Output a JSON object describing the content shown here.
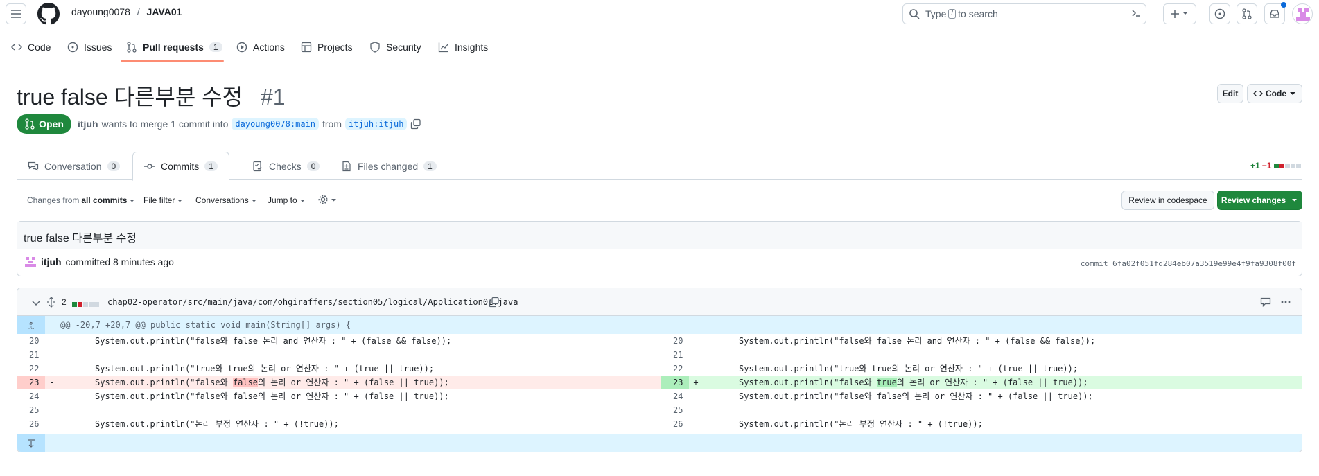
{
  "header": {
    "owner": "dayoung0078",
    "separator": "/",
    "repo": "JAVA01",
    "search_prefix": "Type",
    "search_key": "/",
    "search_suffix": "to search"
  },
  "repo_nav": [
    {
      "label": "Code",
      "icon": "code-icon"
    },
    {
      "label": "Issues",
      "icon": "issue-icon"
    },
    {
      "label": "Pull requests",
      "icon": "pull-request-icon",
      "count": "1"
    },
    {
      "label": "Actions",
      "icon": "play-icon"
    },
    {
      "label": "Projects",
      "icon": "table-icon"
    },
    {
      "label": "Security",
      "icon": "shield-icon"
    },
    {
      "label": "Insights",
      "icon": "graph-icon"
    }
  ],
  "pr": {
    "title": "true false 다른부분 수정",
    "number": "#1",
    "state": "Open",
    "author": "itjuh",
    "merge_text": "wants to merge 1 commit into",
    "base": "dayoung0078:main",
    "from_text": "from",
    "head": "itjuh:itjuh",
    "edit_label": "Edit",
    "code_label": "Code"
  },
  "pr_tabs": [
    {
      "label": "Conversation",
      "count": "0"
    },
    {
      "label": "Commits",
      "count": "1"
    },
    {
      "label": "Checks",
      "count": "0"
    },
    {
      "label": "Files changed",
      "count": "1"
    }
  ],
  "diffstat": {
    "added": "+1",
    "removed": "−1"
  },
  "toolbar": {
    "changes_prefix": "Changes from",
    "changes_value": "all commits",
    "file_filter": "File filter",
    "conversations": "Conversations",
    "jump_to": "Jump to",
    "review_codespace": "Review in codespace",
    "review_changes": "Review changes"
  },
  "commit": {
    "message": "true false 다른부분 수정",
    "author": "itjuh",
    "action": "committed 8 minutes ago",
    "sha_label": "commit 6fa02f051fd284eb07a3519e99e4f9fa9308f00f"
  },
  "file": {
    "changes": "2",
    "path": "chap02-operator/src/main/java/com/ohgiraffers/section05/logical/Application01.java",
    "hunk": "@@ -20,7 +20,7 @@ public static void main(String[] args) {"
  },
  "diff": [
    {
      "left_num": "20",
      "right_num": "20",
      "left": "System.out.println(\"false와 false 논리 and 연산자 : \" + (false && false));",
      "right": "System.out.println(\"false와 false 논리 and 연산자 : \" + (false && false));"
    },
    {
      "left_num": "21",
      "right_num": "21",
      "left": "",
      "right": ""
    },
    {
      "left_num": "22",
      "right_num": "22",
      "left": "System.out.println(\"true와 true의 논리 or 연산자 : \" + (true || true));",
      "right": "System.out.println(\"true와 true의 논리 or 연산자 : \" + (true || true));"
    },
    {
      "left_num": "23",
      "right_num": "23",
      "type": "change",
      "left_a": "System.out.println(\"false와 ",
      "left_hl": "false",
      "left_b": "의 논리 or 연산자 : \" + (false || true));",
      "right_a": "System.out.println(\"false와 ",
      "right_hl": "true",
      "right_b": "의 논리 or 연산자 : \" + (false || true));"
    },
    {
      "left_num": "24",
      "right_num": "24",
      "left": "System.out.println(\"false와 false의 논리 or 연산자 : \" + (false || true));",
      "right": "System.out.println(\"false와 false의 논리 or 연산자 : \" + (false || true));"
    },
    {
      "left_num": "25",
      "right_num": "25",
      "left": "",
      "right": ""
    },
    {
      "left_num": "26",
      "right_num": "26",
      "left": "System.out.println(\"논리 부정 연산자 : \" + (!true));",
      "right": "System.out.println(\"논리 부정 연산자 : \" + (!true));"
    }
  ]
}
